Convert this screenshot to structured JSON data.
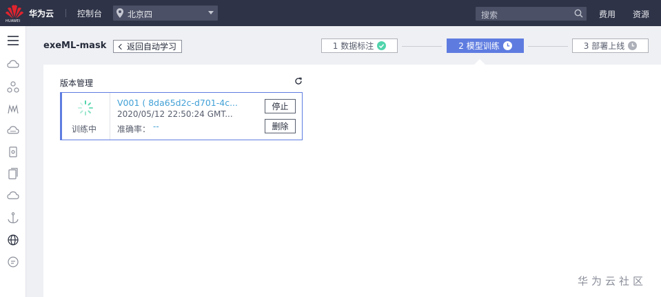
{
  "topbar": {
    "logo_text": "HUAWEI",
    "brand": "华为云",
    "console": "控制台",
    "region": "北京四",
    "search_placeholder": "搜索",
    "nav_fee": "费用",
    "nav_resources": "资源"
  },
  "sidebar": {
    "items": [
      "menu-icon",
      "cloud-icon",
      "nodes-icon",
      "gauge-icon",
      "cloud-upload-icon",
      "container-icon",
      "document-icon",
      "cloud-download-icon",
      "anchor-icon",
      "globe-icon",
      "chat-icon"
    ]
  },
  "header": {
    "project_name": "exeML-mask",
    "back_label": "返回自动学习"
  },
  "steps": [
    {
      "label": "1 数据标注",
      "state": "done",
      "icon": "check-circle-icon"
    },
    {
      "label": "2 模型训练",
      "state": "active",
      "icon": "clock-icon"
    },
    {
      "label": "3 部署上线",
      "state": "pending",
      "icon": "clock-icon"
    }
  ],
  "versions": {
    "title": "版本管理",
    "items": [
      {
        "name": "V001 ( 8da65d2c-d701-4c...",
        "time": "2020/05/12 22:50:24 GMT...",
        "status": "训练中",
        "accuracy_label": "准确率：",
        "accuracy_value": "--",
        "stop_label": "停止",
        "delete_label": "删除"
      }
    ]
  },
  "watermark": "华为云社区",
  "colors": {
    "topbar": "#2e3347",
    "accent": "#5e7ce0",
    "link": "#41a0d6",
    "success": "#50d4ab",
    "brand_red": "#e0242e"
  }
}
